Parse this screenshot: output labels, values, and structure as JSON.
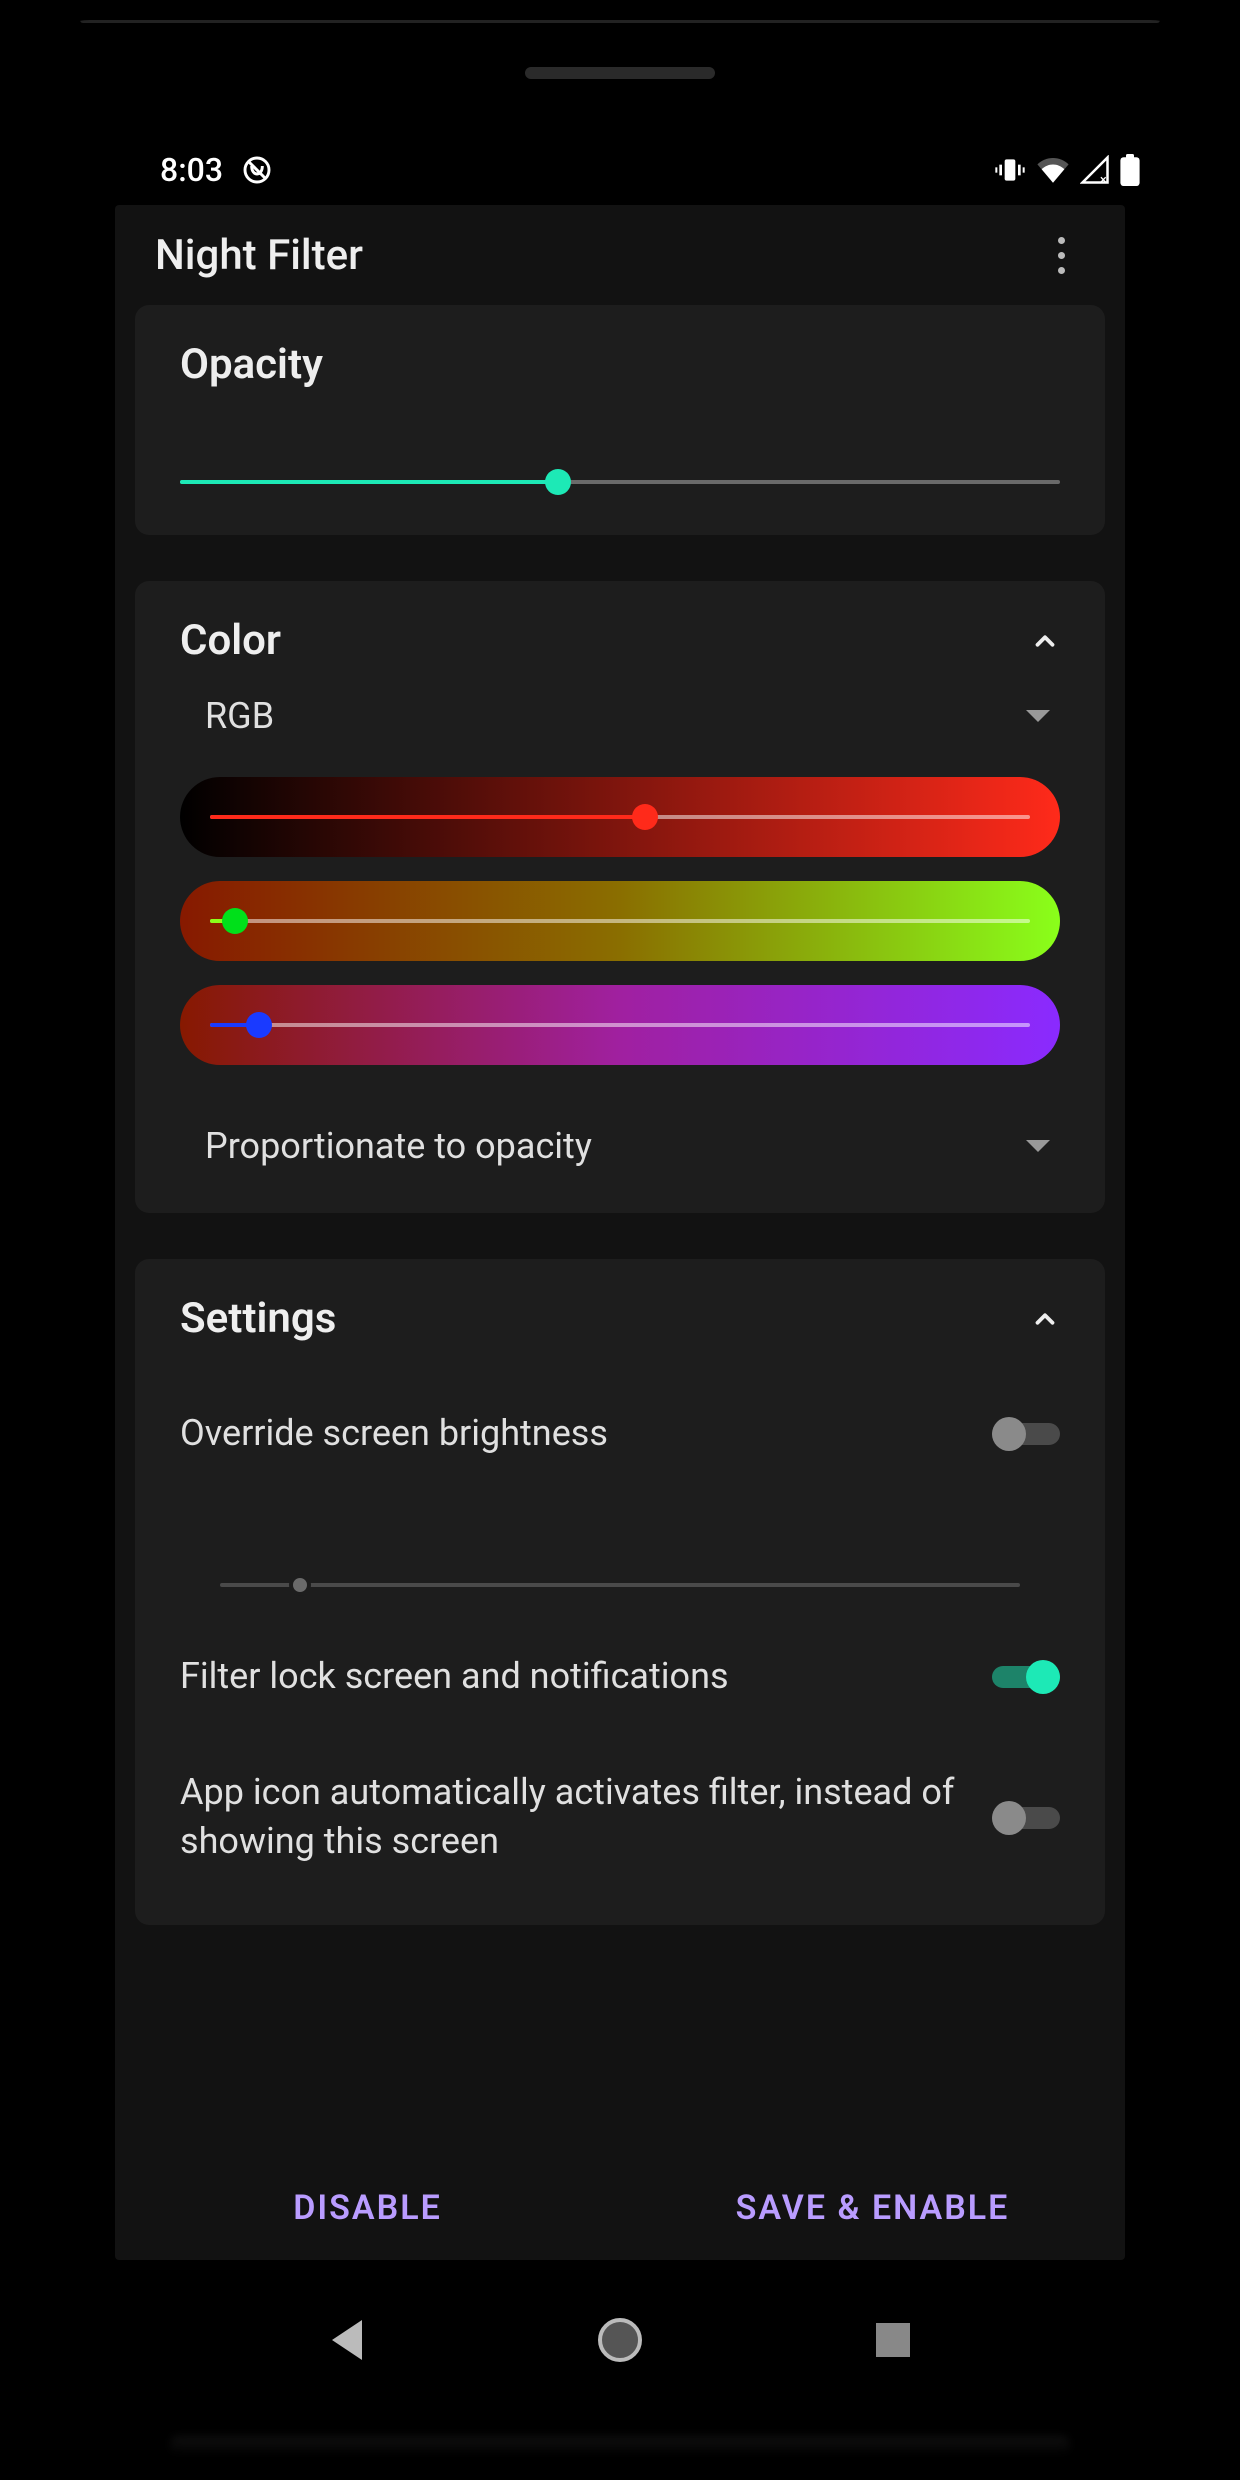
{
  "status": {
    "time": "8:03"
  },
  "app": {
    "title": "Night Filter"
  },
  "opacity": {
    "title": "Opacity",
    "value": 43
  },
  "color": {
    "title": "Color",
    "mode": "RGB",
    "red": 53,
    "green": 3,
    "blue": 6,
    "blend_mode": "Proportionate to opacity"
  },
  "settings": {
    "title": "Settings",
    "override_brightness": {
      "label": "Override screen brightness",
      "enabled": false,
      "value": 10
    },
    "filter_lock": {
      "label": "Filter lock screen and notifications",
      "enabled": true
    },
    "app_icon_activates": {
      "label": "App icon automatically activates filter, instead of showing this screen",
      "enabled": false
    }
  },
  "actions": {
    "disable": "DISABLE",
    "save_enable": "SAVE & ENABLE"
  },
  "colors": {
    "accent": "#1de9b6",
    "action": "#b99cff"
  }
}
